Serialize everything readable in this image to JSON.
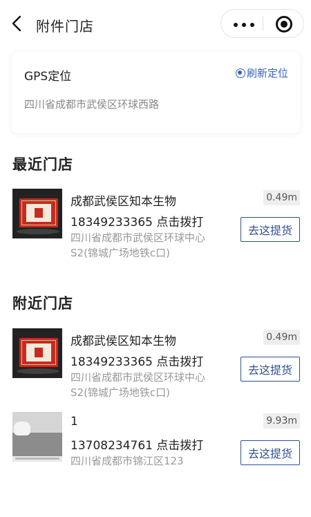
{
  "nav": {
    "title": "附件门店",
    "back_icon": "chevron-left-icon",
    "more_icon": "more-dots-icon",
    "close_icon": "target-circle-icon"
  },
  "gps": {
    "title": "GPS定位",
    "refresh_label": "刷新定位",
    "address": "四川省成都市武侯区环球西路"
  },
  "recent": {
    "title": "最近门店",
    "stores": [
      {
        "name": "成都武侯区知本生物",
        "phone": "18349233365 点击拨打",
        "address": "四川省成都市武侯区环球中心S2(锦城广场地铁c口)",
        "distance": "0.49m",
        "button": "去这提货",
        "image": "red-gift-box"
      }
    ]
  },
  "nearby": {
    "title": "附近门店",
    "stores": [
      {
        "name": "成都武侯区知本生物",
        "phone": "18349233365 点击拨打",
        "address": "四川省成都市武侯区环球中心S2(锦城广场地铁c口)",
        "distance": "0.49m",
        "button": "去这提货",
        "image": "red-gift-box"
      },
      {
        "name": "1",
        "phone": "13708234761 点击拨打",
        "address": "四川省成都市锦江区123",
        "distance": "9.93m",
        "button": "去这提货",
        "image": "bathroom-photo"
      }
    ]
  },
  "colors": {
    "accent": "#3a64b8",
    "button_border": "#2f4f8f",
    "muted_text": "#999999"
  }
}
